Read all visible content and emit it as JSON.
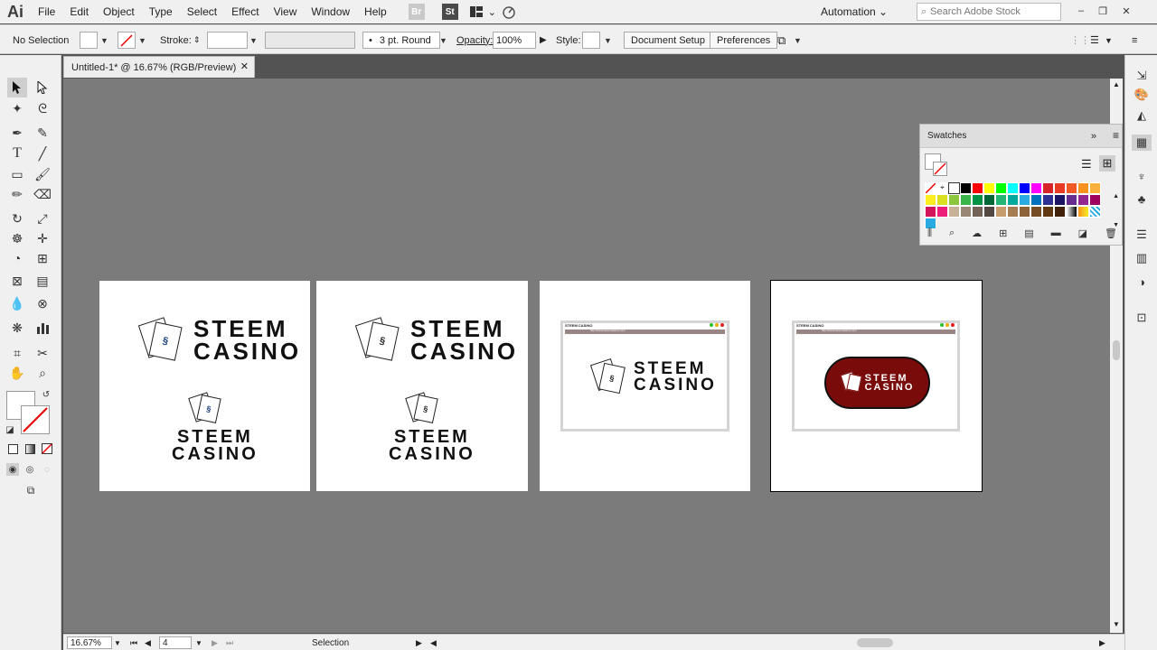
{
  "menubar": {
    "logo": "Ai",
    "items": [
      "File",
      "Edit",
      "Object",
      "Type",
      "Select",
      "Effect",
      "View",
      "Window",
      "Help"
    ],
    "bridge": "Br",
    "stock": "St",
    "workspace": "Automation",
    "search_placeholder": "Search Adobe Stock"
  },
  "controlbar": {
    "selection": "No Selection",
    "stroke_label": "Stroke:",
    "brush": "3 pt. Round",
    "opacity_label": "Opacity:",
    "opacity_value": "100%",
    "style_label": "Style:",
    "doc_setup": "Document Setup",
    "preferences": "Preferences"
  },
  "document": {
    "tab_title": "Untitled-1* @ 16.67% (RGB/Preview)"
  },
  "artwork": {
    "logo_line1": "STEEM",
    "logo_line2": "CASINO",
    "browser_title": "STEEM CASINO",
    "browser_url": "http://www.steemcasino.com/"
  },
  "swatches": {
    "title": "Swatches"
  },
  "status": {
    "zoom": "16.67%",
    "artboard_num": "4",
    "tool": "Selection"
  },
  "colors": {
    "accent": "#7a0b0b",
    "canvas": "#7b7b7b",
    "ui": "#f0f0f0"
  }
}
